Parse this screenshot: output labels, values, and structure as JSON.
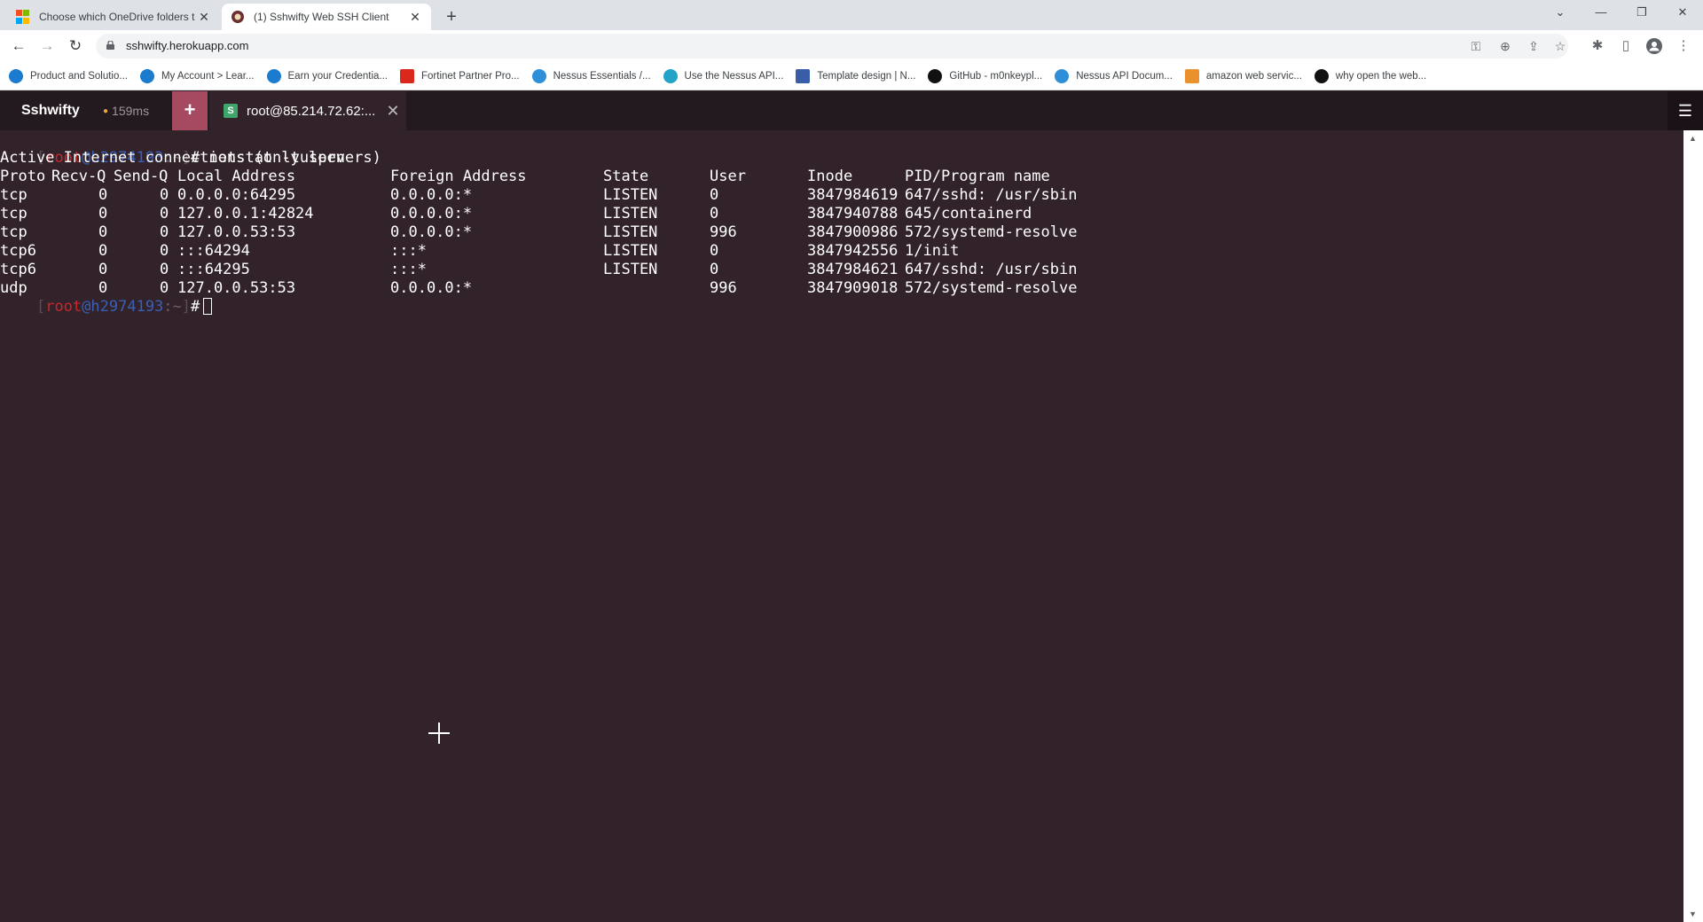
{
  "browser": {
    "tabs": [
      {
        "title": "Choose which OneDrive folders t",
        "close": "✕"
      },
      {
        "title": "(1) Sshwifty Web SSH Client",
        "close": "✕"
      }
    ],
    "new_tab": "+",
    "url": "sshwifty.herokuapp.com",
    "bookmarks": [
      {
        "label": "Product and Solutio...",
        "icon": "dell-icon",
        "color": "#1b7ccf"
      },
      {
        "label": "My Account > Lear...",
        "icon": "dell-icon",
        "color": "#1b7ccf"
      },
      {
        "label": "Earn your Credentia...",
        "icon": "dell-icon",
        "color": "#1b7ccf"
      },
      {
        "label": "Fortinet Partner Pro...",
        "icon": "fortinet-icon",
        "color": "#da291c"
      },
      {
        "label": "Nessus Essentials /...",
        "icon": "tenable-icon",
        "color": "#2e8fd8"
      },
      {
        "label": "Use the Nessus API...",
        "icon": "tenable-icon",
        "color": "#24a3c9"
      },
      {
        "label": "Template design | N...",
        "icon": "hummingbird-icon",
        "color": "#3a5da8"
      },
      {
        "label": "GitHub - m0nkeypl...",
        "icon": "github-icon",
        "color": "#111111"
      },
      {
        "label": "Nessus API Docum...",
        "icon": "tenable-icon",
        "color": "#2e8fd8"
      },
      {
        "label": "amazon web servic...",
        "icon": "aws-icon",
        "color": "#e8912d"
      },
      {
        "label": "why open the web...",
        "icon": "github-icon",
        "color": "#111111"
      }
    ]
  },
  "app": {
    "brand": "Sshwifty",
    "latency": "159ms",
    "add_label": "+",
    "session_icon": "S",
    "session_title": "root@85.214.72.62:...",
    "session_close": "✕",
    "menu_icon": "☰"
  },
  "terminal": {
    "prompt": {
      "open": "[",
      "user": "root",
      "at": "@",
      "host": "h2974193",
      "path": ":~",
      "close": "]",
      "sign": "#"
    },
    "command": " netstat -tulpen",
    "heading": "Active Internet connections (only servers)",
    "columns": [
      "Proto",
      "Recv-Q",
      "Send-Q",
      "Local Address",
      "Foreign Address",
      "State",
      "User",
      "Inode",
      "PID/Program name"
    ],
    "rows": [
      [
        "tcp",
        "0",
        "0",
        "0.0.0.0:64295",
        "0.0.0.0:*",
        "LISTEN",
        "0",
        "3847984619",
        "647/sshd: /usr/sbin"
      ],
      [
        "tcp",
        "0",
        "0",
        "127.0.0.1:42824",
        "0.0.0.0:*",
        "LISTEN",
        "0",
        "3847940788",
        "645/containerd"
      ],
      [
        "tcp",
        "0",
        "0",
        "127.0.0.53:53",
        "0.0.0.0:*",
        "LISTEN",
        "996",
        "3847900986",
        "572/systemd-resolve"
      ],
      [
        "tcp6",
        "0",
        "0",
        ":::64294",
        ":::*",
        "LISTEN",
        "0",
        "3847942556",
        "1/init"
      ],
      [
        "tcp6",
        "0",
        "0",
        ":::64295",
        ":::*",
        "LISTEN",
        "0",
        "3847984621",
        "647/sshd: /usr/sbin"
      ],
      [
        "udp",
        "0",
        "0",
        "127.0.0.53:53",
        "0.0.0.0:*",
        "",
        "996",
        "3847909018",
        "572/systemd-resolve"
      ]
    ]
  }
}
